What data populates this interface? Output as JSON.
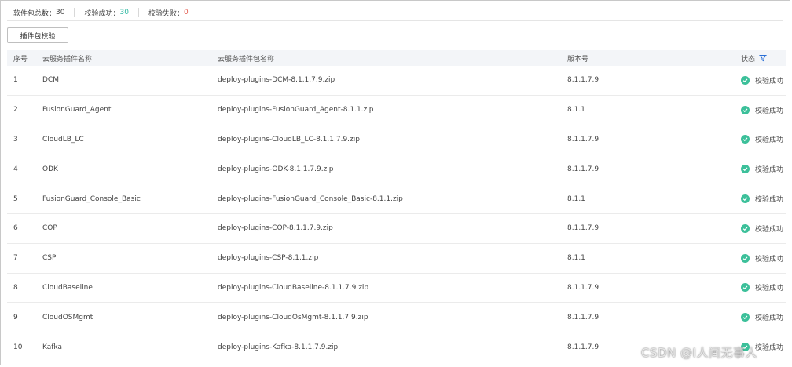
{
  "summary": {
    "total_label": "软件包总数：",
    "total_value": "30",
    "success_label": "校验成功：",
    "success_value": "30",
    "fail_label": "校验失败：",
    "fail_value": "0"
  },
  "toolbar": {
    "verify_button": "插件包校验"
  },
  "table": {
    "headers": {
      "index": "序号",
      "service_name": "云服务插件名称",
      "file_name": "云服务插件包名称",
      "version": "版本号",
      "status": "状态"
    },
    "rows": [
      {
        "index": "1",
        "service_name": "DCM",
        "file_name": "deploy-plugins-DCM-8.1.1.7.9.zip",
        "version": "8.1.1.7.9",
        "status": "校验成功"
      },
      {
        "index": "2",
        "service_name": "FusionGuard_Agent",
        "file_name": "deploy-plugins-FusionGuard_Agent-8.1.1.zip",
        "version": "8.1.1",
        "status": "校验成功"
      },
      {
        "index": "3",
        "service_name": "CloudLB_LC",
        "file_name": "deploy-plugins-CloudLB_LC-8.1.1.7.9.zip",
        "version": "8.1.1.7.9",
        "status": "校验成功"
      },
      {
        "index": "4",
        "service_name": "ODK",
        "file_name": "deploy-plugins-ODK-8.1.1.7.9.zip",
        "version": "8.1.1.7.9",
        "status": "校验成功"
      },
      {
        "index": "5",
        "service_name": "FusionGuard_Console_Basic",
        "file_name": "deploy-plugins-FusionGuard_Console_Basic-8.1.1.zip",
        "version": "8.1.1",
        "status": "校验成功"
      },
      {
        "index": "6",
        "service_name": "COP",
        "file_name": "deploy-plugins-COP-8.1.1.7.9.zip",
        "version": "8.1.1.7.9",
        "status": "校验成功"
      },
      {
        "index": "7",
        "service_name": "CSP",
        "file_name": "deploy-plugins-CSP-8.1.1.zip",
        "version": "8.1.1",
        "status": "校验成功"
      },
      {
        "index": "8",
        "service_name": "CloudBaseline",
        "file_name": "deploy-plugins-CloudBaseline-8.1.1.7.9.zip",
        "version": "8.1.1.7.9",
        "status": "校验成功"
      },
      {
        "index": "9",
        "service_name": "CloudOSMgmt",
        "file_name": "deploy-plugins-CloudOsMgmt-8.1.1.7.9.zip",
        "version": "8.1.1.7.9",
        "status": "校验成功"
      },
      {
        "index": "10",
        "service_name": "Kafka",
        "file_name": "deploy-plugins-Kafka-8.1.1.7.9.zip",
        "version": "8.1.1.7.9",
        "status": "校验成功"
      }
    ]
  },
  "watermark": "CSDN @I人间无事人",
  "colors": {
    "success": "#3cc09a",
    "accent": "#2a6fd6",
    "fail": "#e45c4f"
  },
  "icons": {
    "status": "check-circle-icon",
    "filter": "filter-icon"
  }
}
